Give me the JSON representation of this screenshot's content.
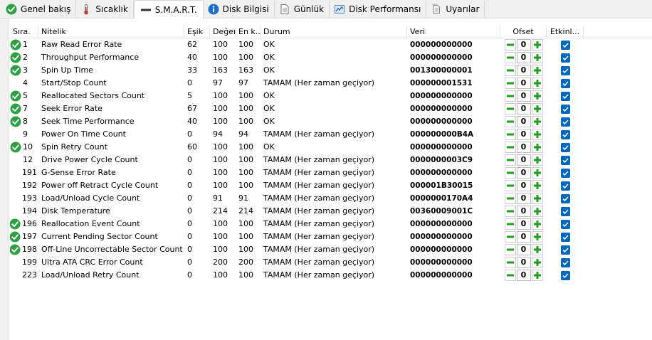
{
  "tabs": [
    {
      "label": "Genel bakış",
      "icon": "ok-check-icon",
      "active": false
    },
    {
      "label": "Sıcaklık",
      "icon": "thermometer-icon",
      "active": false
    },
    {
      "label": "S.M.A.R.T.",
      "icon": "dash-icon",
      "active": true
    },
    {
      "label": "Disk Bilgisi",
      "icon": "info-icon",
      "active": false
    },
    {
      "label": "Günlük",
      "icon": "log-document-icon",
      "active": false
    },
    {
      "label": "Disk Performansı",
      "icon": "performance-chart-icon",
      "active": false
    },
    {
      "label": "Uyarılar",
      "icon": "alerts-document-icon",
      "active": false
    }
  ],
  "columns": {
    "no": "Sıra.",
    "name": "Nitelik",
    "threshold": "Eşik",
    "current": "Değer",
    "worst": "En k...",
    "status": "Durum",
    "raw": "Veri",
    "offset": "Ofset",
    "enabled": "Etkinl..."
  },
  "colors": {
    "ok": "#2ea043",
    "checkbox": "#0067c0",
    "minus": "#1e9e1e",
    "plus": "#1e9e1e"
  },
  "rows": [
    {
      "no": "1",
      "name": "Raw Read Error Rate",
      "thr": "62",
      "cur": "100",
      "wor": "100",
      "status": "OK",
      "raw": "000000000000",
      "offset": "0",
      "ok": true
    },
    {
      "no": "2",
      "name": "Throughput Performance",
      "thr": "40",
      "cur": "100",
      "wor": "100",
      "status": "OK",
      "raw": "000000000000",
      "offset": "0",
      "ok": true
    },
    {
      "no": "3",
      "name": "Spin Up Time",
      "thr": "33",
      "cur": "163",
      "wor": "163",
      "status": "OK",
      "raw": "001300000001",
      "offset": "0",
      "ok": true
    },
    {
      "no": "4",
      "name": "Start/Stop Count",
      "thr": "0",
      "cur": "97",
      "wor": "97",
      "status": "TAMAM (Her zaman geçiyor)",
      "raw": "000000001531",
      "offset": "0",
      "ok": false
    },
    {
      "no": "5",
      "name": "Reallocated Sectors Count",
      "thr": "5",
      "cur": "100",
      "wor": "100",
      "status": "OK",
      "raw": "000000000000",
      "offset": "0",
      "ok": true
    },
    {
      "no": "7",
      "name": "Seek Error Rate",
      "thr": "67",
      "cur": "100",
      "wor": "100",
      "status": "OK",
      "raw": "000000000000",
      "offset": "0",
      "ok": true
    },
    {
      "no": "8",
      "name": "Seek Time Performance",
      "thr": "40",
      "cur": "100",
      "wor": "100",
      "status": "OK",
      "raw": "000000000000",
      "offset": "0",
      "ok": true
    },
    {
      "no": "9",
      "name": "Power On Time Count",
      "thr": "0",
      "cur": "94",
      "wor": "94",
      "status": "TAMAM (Her zaman geçiyor)",
      "raw": "000000000B4A",
      "offset": "0",
      "ok": false
    },
    {
      "no": "10",
      "name": "Spin Retry Count",
      "thr": "60",
      "cur": "100",
      "wor": "100",
      "status": "OK",
      "raw": "000000000000",
      "offset": "0",
      "ok": true
    },
    {
      "no": "12",
      "name": "Drive Power Cycle Count",
      "thr": "0",
      "cur": "100",
      "wor": "100",
      "status": "TAMAM (Her zaman geçiyor)",
      "raw": "0000000003C9",
      "offset": "0",
      "ok": false
    },
    {
      "no": "191",
      "name": "G-Sense Error Rate",
      "thr": "0",
      "cur": "100",
      "wor": "100",
      "status": "TAMAM (Her zaman geçiyor)",
      "raw": "000000000000",
      "offset": "0",
      "ok": false
    },
    {
      "no": "192",
      "name": "Power off Retract Cycle Count",
      "thr": "0",
      "cur": "100",
      "wor": "100",
      "status": "TAMAM (Her zaman geçiyor)",
      "raw": "000001B30015",
      "offset": "0",
      "ok": false
    },
    {
      "no": "193",
      "name": "Load/Unload Cycle Count",
      "thr": "0",
      "cur": "91",
      "wor": "91",
      "status": "TAMAM (Her zaman geçiyor)",
      "raw": "0000000170A4",
      "offset": "0",
      "ok": false
    },
    {
      "no": "194",
      "name": "Disk Temperature",
      "thr": "0",
      "cur": "214",
      "wor": "214",
      "status": "TAMAM (Her zaman geçiyor)",
      "raw": "00360009001C",
      "offset": "0",
      "ok": false
    },
    {
      "no": "196",
      "name": "Reallocation Event Count",
      "thr": "0",
      "cur": "100",
      "wor": "100",
      "status": "TAMAM (Her zaman geçiyor)",
      "raw": "000000000000",
      "offset": "0",
      "ok": true
    },
    {
      "no": "197",
      "name": "Current Pending Sector Count",
      "thr": "0",
      "cur": "100",
      "wor": "100",
      "status": "TAMAM (Her zaman geçiyor)",
      "raw": "000000000000",
      "offset": "0",
      "ok": true
    },
    {
      "no": "198",
      "name": "Off-Line Uncorrectable Sector Count",
      "thr": "0",
      "cur": "100",
      "wor": "100",
      "status": "TAMAM (Her zaman geçiyor)",
      "raw": "000000000000",
      "offset": "0",
      "ok": true
    },
    {
      "no": "199",
      "name": "Ultra ATA CRC Error Count",
      "thr": "0",
      "cur": "200",
      "wor": "200",
      "status": "TAMAM (Her zaman geçiyor)",
      "raw": "000000000000",
      "offset": "0",
      "ok": false
    },
    {
      "no": "223",
      "name": "Load/Unload Retry Count",
      "thr": "0",
      "cur": "100",
      "wor": "100",
      "status": "TAMAM (Her zaman geçiyor)",
      "raw": "000000000000",
      "offset": "0",
      "ok": false
    }
  ]
}
